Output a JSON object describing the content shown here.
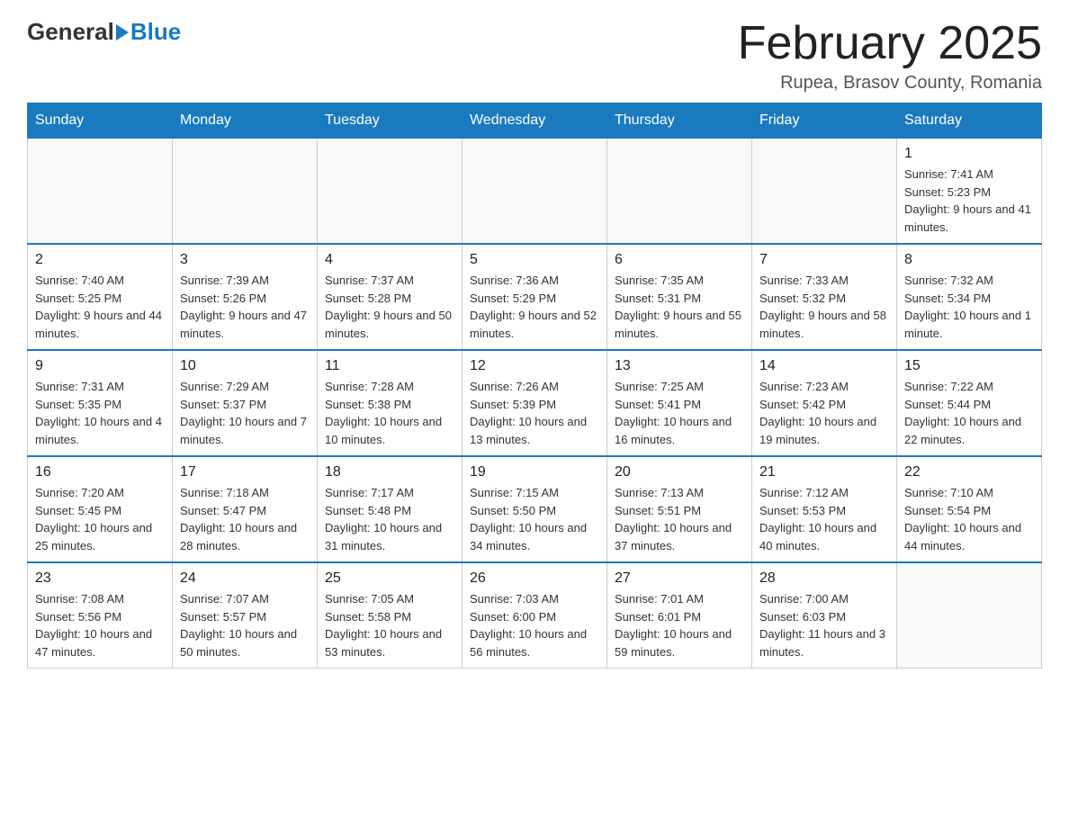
{
  "header": {
    "logo_general": "General",
    "logo_blue": "Blue",
    "month_title": "February 2025",
    "location": "Rupea, Brasov County, Romania"
  },
  "weekdays": [
    "Sunday",
    "Monday",
    "Tuesday",
    "Wednesday",
    "Thursday",
    "Friday",
    "Saturday"
  ],
  "weeks": [
    [
      {
        "day": "",
        "info": ""
      },
      {
        "day": "",
        "info": ""
      },
      {
        "day": "",
        "info": ""
      },
      {
        "day": "",
        "info": ""
      },
      {
        "day": "",
        "info": ""
      },
      {
        "day": "",
        "info": ""
      },
      {
        "day": "1",
        "info": "Sunrise: 7:41 AM\nSunset: 5:23 PM\nDaylight: 9 hours and 41 minutes."
      }
    ],
    [
      {
        "day": "2",
        "info": "Sunrise: 7:40 AM\nSunset: 5:25 PM\nDaylight: 9 hours and 44 minutes."
      },
      {
        "day": "3",
        "info": "Sunrise: 7:39 AM\nSunset: 5:26 PM\nDaylight: 9 hours and 47 minutes."
      },
      {
        "day": "4",
        "info": "Sunrise: 7:37 AM\nSunset: 5:28 PM\nDaylight: 9 hours and 50 minutes."
      },
      {
        "day": "5",
        "info": "Sunrise: 7:36 AM\nSunset: 5:29 PM\nDaylight: 9 hours and 52 minutes."
      },
      {
        "day": "6",
        "info": "Sunrise: 7:35 AM\nSunset: 5:31 PM\nDaylight: 9 hours and 55 minutes."
      },
      {
        "day": "7",
        "info": "Sunrise: 7:33 AM\nSunset: 5:32 PM\nDaylight: 9 hours and 58 minutes."
      },
      {
        "day": "8",
        "info": "Sunrise: 7:32 AM\nSunset: 5:34 PM\nDaylight: 10 hours and 1 minute."
      }
    ],
    [
      {
        "day": "9",
        "info": "Sunrise: 7:31 AM\nSunset: 5:35 PM\nDaylight: 10 hours and 4 minutes."
      },
      {
        "day": "10",
        "info": "Sunrise: 7:29 AM\nSunset: 5:37 PM\nDaylight: 10 hours and 7 minutes."
      },
      {
        "day": "11",
        "info": "Sunrise: 7:28 AM\nSunset: 5:38 PM\nDaylight: 10 hours and 10 minutes."
      },
      {
        "day": "12",
        "info": "Sunrise: 7:26 AM\nSunset: 5:39 PM\nDaylight: 10 hours and 13 minutes."
      },
      {
        "day": "13",
        "info": "Sunrise: 7:25 AM\nSunset: 5:41 PM\nDaylight: 10 hours and 16 minutes."
      },
      {
        "day": "14",
        "info": "Sunrise: 7:23 AM\nSunset: 5:42 PM\nDaylight: 10 hours and 19 minutes."
      },
      {
        "day": "15",
        "info": "Sunrise: 7:22 AM\nSunset: 5:44 PM\nDaylight: 10 hours and 22 minutes."
      }
    ],
    [
      {
        "day": "16",
        "info": "Sunrise: 7:20 AM\nSunset: 5:45 PM\nDaylight: 10 hours and 25 minutes."
      },
      {
        "day": "17",
        "info": "Sunrise: 7:18 AM\nSunset: 5:47 PM\nDaylight: 10 hours and 28 minutes."
      },
      {
        "day": "18",
        "info": "Sunrise: 7:17 AM\nSunset: 5:48 PM\nDaylight: 10 hours and 31 minutes."
      },
      {
        "day": "19",
        "info": "Sunrise: 7:15 AM\nSunset: 5:50 PM\nDaylight: 10 hours and 34 minutes."
      },
      {
        "day": "20",
        "info": "Sunrise: 7:13 AM\nSunset: 5:51 PM\nDaylight: 10 hours and 37 minutes."
      },
      {
        "day": "21",
        "info": "Sunrise: 7:12 AM\nSunset: 5:53 PM\nDaylight: 10 hours and 40 minutes."
      },
      {
        "day": "22",
        "info": "Sunrise: 7:10 AM\nSunset: 5:54 PM\nDaylight: 10 hours and 44 minutes."
      }
    ],
    [
      {
        "day": "23",
        "info": "Sunrise: 7:08 AM\nSunset: 5:56 PM\nDaylight: 10 hours and 47 minutes."
      },
      {
        "day": "24",
        "info": "Sunrise: 7:07 AM\nSunset: 5:57 PM\nDaylight: 10 hours and 50 minutes."
      },
      {
        "day": "25",
        "info": "Sunrise: 7:05 AM\nSunset: 5:58 PM\nDaylight: 10 hours and 53 minutes."
      },
      {
        "day": "26",
        "info": "Sunrise: 7:03 AM\nSunset: 6:00 PM\nDaylight: 10 hours and 56 minutes."
      },
      {
        "day": "27",
        "info": "Sunrise: 7:01 AM\nSunset: 6:01 PM\nDaylight: 10 hours and 59 minutes."
      },
      {
        "day": "28",
        "info": "Sunrise: 7:00 AM\nSunset: 6:03 PM\nDaylight: 11 hours and 3 minutes."
      },
      {
        "day": "",
        "info": ""
      }
    ]
  ]
}
